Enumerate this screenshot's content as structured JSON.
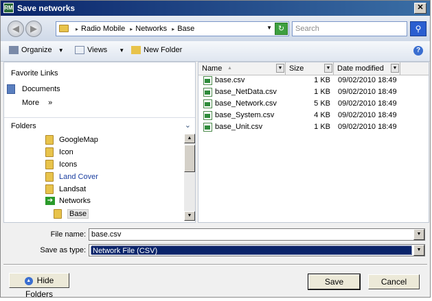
{
  "window": {
    "title": "Save networks",
    "app_icon_text": "RM"
  },
  "address": {
    "crumbs": [
      "Radio Mobile",
      "Networks",
      "Base"
    ]
  },
  "search": {
    "placeholder": "Search"
  },
  "toolbar": {
    "organize": "Organize",
    "views": "Views",
    "new_folder": "New Folder"
  },
  "left": {
    "favorite_links": "Favorite Links",
    "documents": "Documents",
    "more": "More",
    "folders": "Folders",
    "tree": [
      "GoogleMap",
      "Icon",
      "Icons",
      "Land Cover",
      "Landsat",
      "Networks",
      "Base"
    ]
  },
  "columns": {
    "name": "Name",
    "size": "Size",
    "date": "Date modified"
  },
  "files": [
    {
      "name": "base.csv",
      "size": "1 KB",
      "date": "09/02/2010 18:49"
    },
    {
      "name": "base_NetData.csv",
      "size": "1 KB",
      "date": "09/02/2010 18:49"
    },
    {
      "name": "base_Network.csv",
      "size": "5 KB",
      "date": "09/02/2010 18:49"
    },
    {
      "name": "base_System.csv",
      "size": "4 KB",
      "date": "09/02/2010 18:49"
    },
    {
      "name": "base_Unit.csv",
      "size": "1 KB",
      "date": "09/02/2010 18:49"
    }
  ],
  "form": {
    "file_name_label": "File name:",
    "file_name_value": "base.csv",
    "save_as_type_label": "Save as type:",
    "save_as_type_value": "Network File (CSV)"
  },
  "footer": {
    "hide_folders": "Hide Folders",
    "save": "Save",
    "cancel": "Cancel"
  },
  "colors": {
    "title_bar": "#0a246a",
    "selection": "#0a246a",
    "link": "#1a3ea0"
  }
}
